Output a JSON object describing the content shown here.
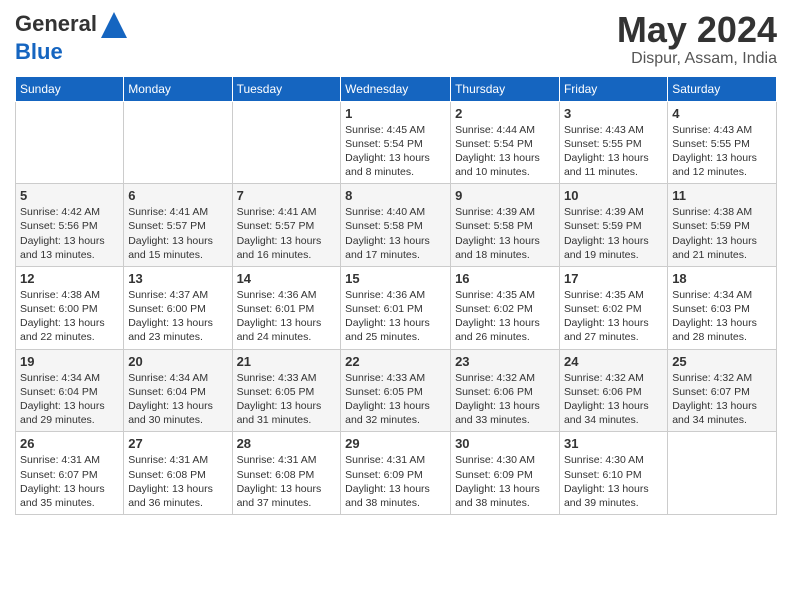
{
  "header": {
    "logo_general": "General",
    "logo_blue": "Blue",
    "month_title": "May 2024",
    "location": "Dispur, Assam, India"
  },
  "days_of_week": [
    "Sunday",
    "Monday",
    "Tuesday",
    "Wednesday",
    "Thursday",
    "Friday",
    "Saturday"
  ],
  "weeks": [
    [
      {
        "day": "",
        "info": ""
      },
      {
        "day": "",
        "info": ""
      },
      {
        "day": "",
        "info": ""
      },
      {
        "day": "1",
        "info": "Sunrise: 4:45 AM\nSunset: 5:54 PM\nDaylight: 13 hours and 8 minutes."
      },
      {
        "day": "2",
        "info": "Sunrise: 4:44 AM\nSunset: 5:54 PM\nDaylight: 13 hours and 10 minutes."
      },
      {
        "day": "3",
        "info": "Sunrise: 4:43 AM\nSunset: 5:55 PM\nDaylight: 13 hours and 11 minutes."
      },
      {
        "day": "4",
        "info": "Sunrise: 4:43 AM\nSunset: 5:55 PM\nDaylight: 13 hours and 12 minutes."
      }
    ],
    [
      {
        "day": "5",
        "info": "Sunrise: 4:42 AM\nSunset: 5:56 PM\nDaylight: 13 hours and 13 minutes."
      },
      {
        "day": "6",
        "info": "Sunrise: 4:41 AM\nSunset: 5:57 PM\nDaylight: 13 hours and 15 minutes."
      },
      {
        "day": "7",
        "info": "Sunrise: 4:41 AM\nSunset: 5:57 PM\nDaylight: 13 hours and 16 minutes."
      },
      {
        "day": "8",
        "info": "Sunrise: 4:40 AM\nSunset: 5:58 PM\nDaylight: 13 hours and 17 minutes."
      },
      {
        "day": "9",
        "info": "Sunrise: 4:39 AM\nSunset: 5:58 PM\nDaylight: 13 hours and 18 minutes."
      },
      {
        "day": "10",
        "info": "Sunrise: 4:39 AM\nSunset: 5:59 PM\nDaylight: 13 hours and 19 minutes."
      },
      {
        "day": "11",
        "info": "Sunrise: 4:38 AM\nSunset: 5:59 PM\nDaylight: 13 hours and 21 minutes."
      }
    ],
    [
      {
        "day": "12",
        "info": "Sunrise: 4:38 AM\nSunset: 6:00 PM\nDaylight: 13 hours and 22 minutes."
      },
      {
        "day": "13",
        "info": "Sunrise: 4:37 AM\nSunset: 6:00 PM\nDaylight: 13 hours and 23 minutes."
      },
      {
        "day": "14",
        "info": "Sunrise: 4:36 AM\nSunset: 6:01 PM\nDaylight: 13 hours and 24 minutes."
      },
      {
        "day": "15",
        "info": "Sunrise: 4:36 AM\nSunset: 6:01 PM\nDaylight: 13 hours and 25 minutes."
      },
      {
        "day": "16",
        "info": "Sunrise: 4:35 AM\nSunset: 6:02 PM\nDaylight: 13 hours and 26 minutes."
      },
      {
        "day": "17",
        "info": "Sunrise: 4:35 AM\nSunset: 6:02 PM\nDaylight: 13 hours and 27 minutes."
      },
      {
        "day": "18",
        "info": "Sunrise: 4:34 AM\nSunset: 6:03 PM\nDaylight: 13 hours and 28 minutes."
      }
    ],
    [
      {
        "day": "19",
        "info": "Sunrise: 4:34 AM\nSunset: 6:04 PM\nDaylight: 13 hours and 29 minutes."
      },
      {
        "day": "20",
        "info": "Sunrise: 4:34 AM\nSunset: 6:04 PM\nDaylight: 13 hours and 30 minutes."
      },
      {
        "day": "21",
        "info": "Sunrise: 4:33 AM\nSunset: 6:05 PM\nDaylight: 13 hours and 31 minutes."
      },
      {
        "day": "22",
        "info": "Sunrise: 4:33 AM\nSunset: 6:05 PM\nDaylight: 13 hours and 32 minutes."
      },
      {
        "day": "23",
        "info": "Sunrise: 4:32 AM\nSunset: 6:06 PM\nDaylight: 13 hours and 33 minutes."
      },
      {
        "day": "24",
        "info": "Sunrise: 4:32 AM\nSunset: 6:06 PM\nDaylight: 13 hours and 34 minutes."
      },
      {
        "day": "25",
        "info": "Sunrise: 4:32 AM\nSunset: 6:07 PM\nDaylight: 13 hours and 34 minutes."
      }
    ],
    [
      {
        "day": "26",
        "info": "Sunrise: 4:31 AM\nSunset: 6:07 PM\nDaylight: 13 hours and 35 minutes."
      },
      {
        "day": "27",
        "info": "Sunrise: 4:31 AM\nSunset: 6:08 PM\nDaylight: 13 hours and 36 minutes."
      },
      {
        "day": "28",
        "info": "Sunrise: 4:31 AM\nSunset: 6:08 PM\nDaylight: 13 hours and 37 minutes."
      },
      {
        "day": "29",
        "info": "Sunrise: 4:31 AM\nSunset: 6:09 PM\nDaylight: 13 hours and 38 minutes."
      },
      {
        "day": "30",
        "info": "Sunrise: 4:30 AM\nSunset: 6:09 PM\nDaylight: 13 hours and 38 minutes."
      },
      {
        "day": "31",
        "info": "Sunrise: 4:30 AM\nSunset: 6:10 PM\nDaylight: 13 hours and 39 minutes."
      },
      {
        "day": "",
        "info": ""
      }
    ]
  ]
}
